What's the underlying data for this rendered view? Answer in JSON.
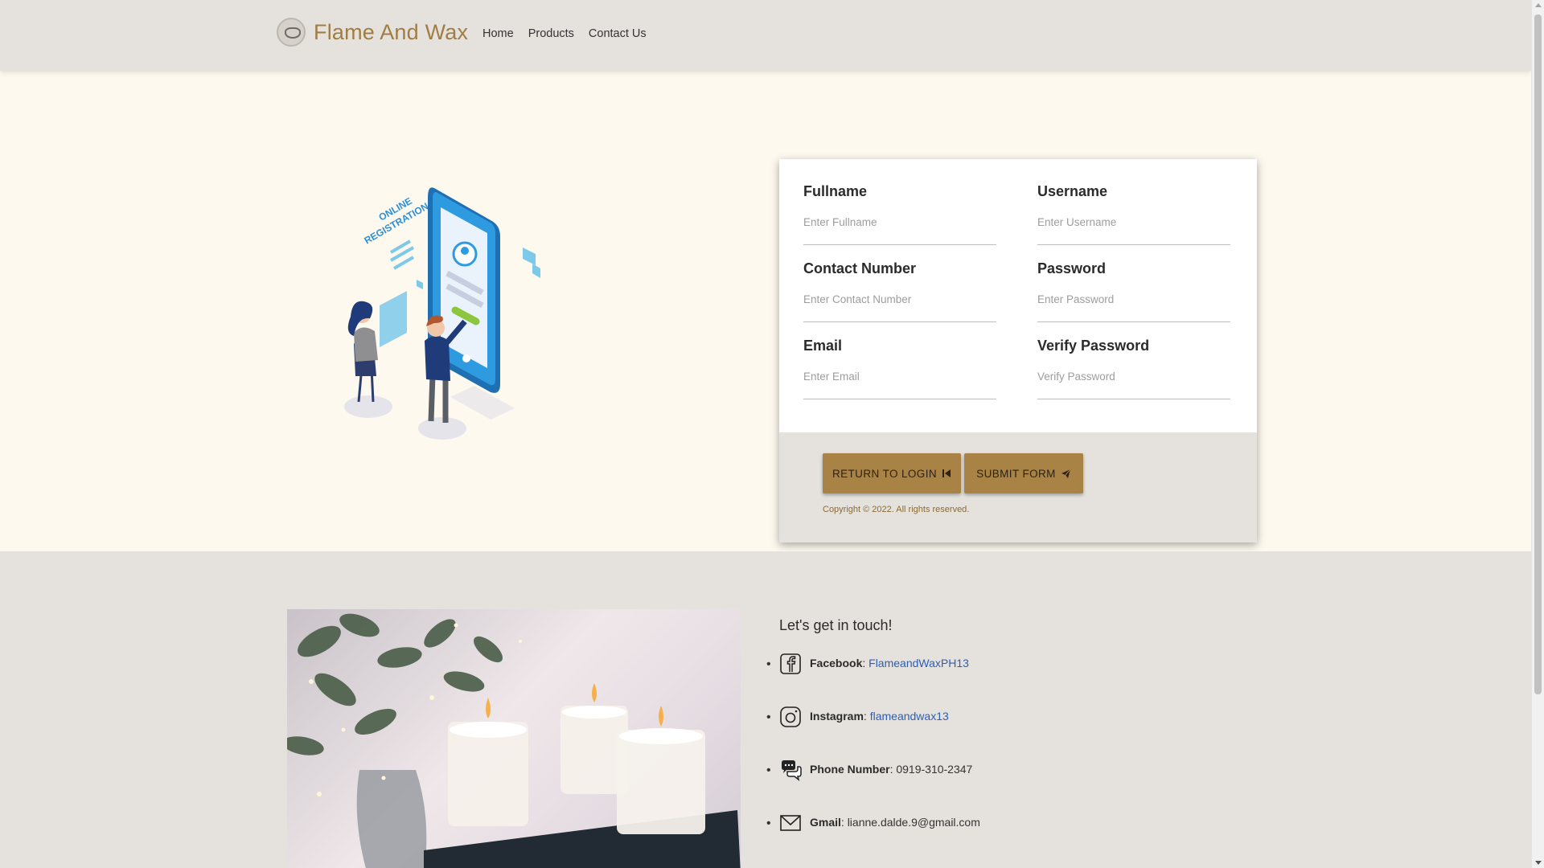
{
  "navbar": {
    "brand": "Flame And Wax",
    "links": [
      "Home",
      "Products",
      "Contact Us"
    ]
  },
  "form": {
    "fields": [
      {
        "label": "Fullname",
        "placeholder": "Enter Fullname"
      },
      {
        "label": "Username",
        "placeholder": "Enter Username"
      },
      {
        "label": "Contact Number",
        "placeholder": "Enter Contact Number"
      },
      {
        "label": "Password",
        "placeholder": "Enter Password"
      },
      {
        "label": "Email",
        "placeholder": "Enter Email"
      },
      {
        "label": "Verify Password",
        "placeholder": "Verify Password"
      }
    ],
    "return_label": "RETURN TO LOGIN",
    "submit_label": "SUBMIT FORM",
    "copyright": "Copyright © 2022. All rights reserved."
  },
  "illustration": {
    "text_line1": "ONLINE",
    "text_line2": "REGISTRATION"
  },
  "contact": {
    "title": "Let's get in touch!",
    "items": [
      {
        "label": "Facebook",
        "sep": ": ",
        "value": "FlameandWaxPH13",
        "icon": "facebook-icon"
      },
      {
        "label": "Instagram",
        "sep": ": ",
        "value": "flameandwax13",
        "icon": "instagram-icon"
      },
      {
        "label": "Phone Number",
        "sep": ": ",
        "value": "0919-310-2347",
        "icon": "chat-bubbles-icon"
      },
      {
        "label": "Gmail",
        "sep": ": ",
        "value": "lianne.dalde.9@gmail.com",
        "icon": "mail-icon"
      }
    ]
  },
  "colors": {
    "brand": "#a07d43",
    "button": "#a88345",
    "hero_bg": "#fdf9ef",
    "navbar_bg": "#e5e2dd",
    "link": "#2a5fb8"
  }
}
